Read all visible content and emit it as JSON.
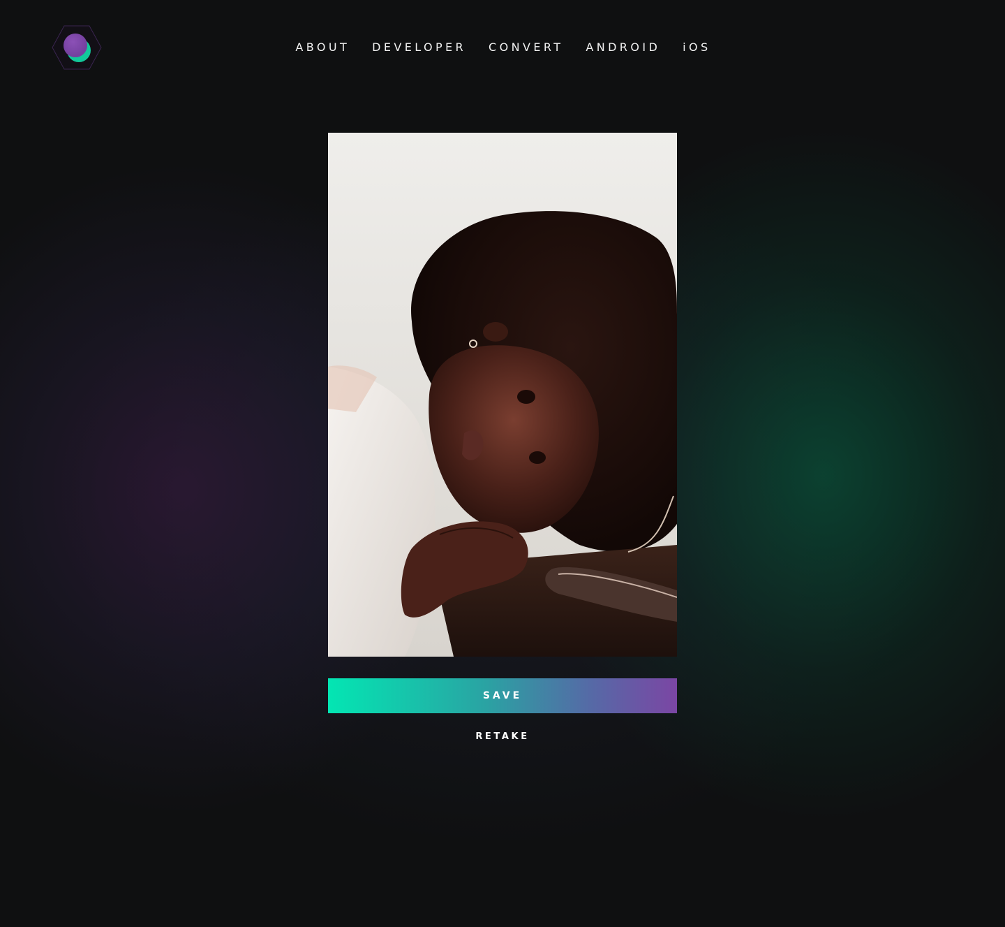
{
  "header": {
    "logo_icon": "hexagon-overlapping-circles-icon",
    "nav": [
      {
        "label": "ABOUT"
      },
      {
        "label": "DEVELOPER"
      },
      {
        "label": "CONVERT"
      },
      {
        "label": "ANDROID"
      },
      {
        "label": "iOS"
      }
    ]
  },
  "main": {
    "photo_icon": "captured-photo",
    "save_label": "SAVE",
    "retake_label": "RETAKE"
  },
  "colors": {
    "background": "#0f1011",
    "accent_green": "#03e6b3",
    "accent_purple": "#7b46a4",
    "text": "#ffffff"
  }
}
